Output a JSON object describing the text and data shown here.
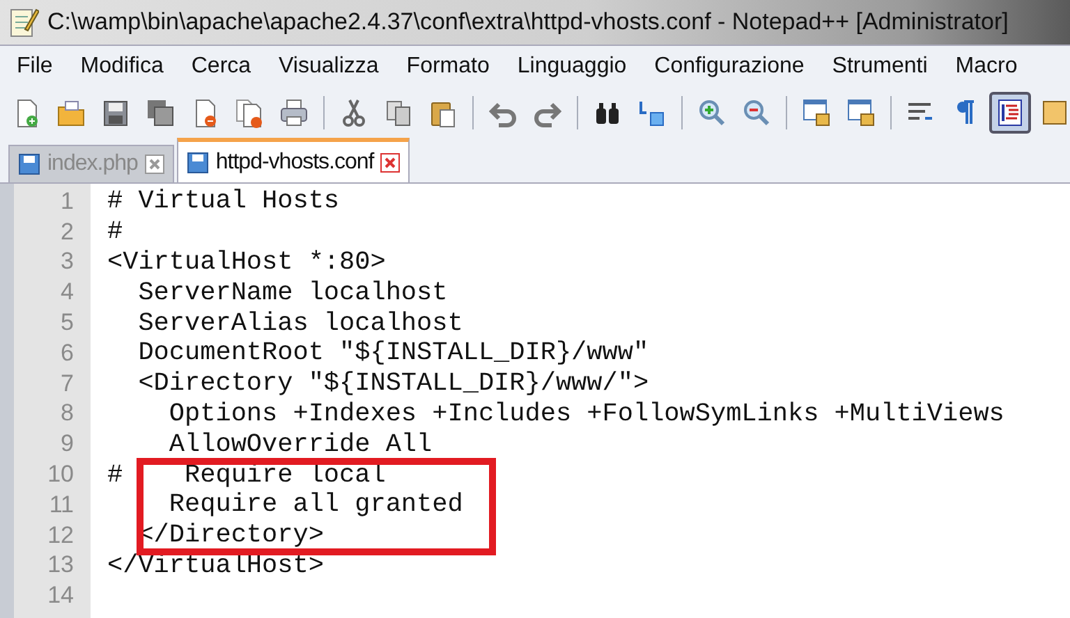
{
  "window": {
    "title": "C:\\wamp\\bin\\apache\\apache2.4.37\\conf\\extra\\httpd-vhosts.conf - Notepad++ [Administrator]"
  },
  "menu": [
    "File",
    "Modifica",
    "Cerca",
    "Visualizza",
    "Formato",
    "Linguaggio",
    "Configurazione",
    "Strumenti",
    "Macro"
  ],
  "toolbar": {
    "buttons": [
      {
        "pressed": false
      },
      {
        "pressed": false
      },
      {
        "pressed": false
      },
      {
        "pressed": false
      },
      {
        "pressed": false
      },
      {
        "pressed": false
      },
      {
        "pressed": false
      },
      {
        "pressed": false
      },
      {
        "pressed": false
      },
      {
        "pressed": false
      },
      {
        "pressed": false
      },
      {
        "pressed": false
      },
      {
        "pressed": false
      },
      {
        "pressed": false
      },
      {
        "pressed": false
      },
      {
        "pressed": false
      },
      {
        "pressed": false
      },
      {
        "pressed": false
      },
      {
        "pressed": false
      },
      {
        "pressed": false
      },
      {
        "pressed": true
      },
      {
        "pressed": false
      }
    ]
  },
  "tabs": [
    {
      "label": "index.php",
      "selected": false
    },
    {
      "label": "httpd-vhosts.conf",
      "selected": true
    }
  ],
  "editor": {
    "lines": [
      {
        "number": "1",
        "code": "# Virtual Hosts",
        "highlighted": false
      },
      {
        "number": "2",
        "code": "#",
        "highlighted": false
      },
      {
        "number": "3",
        "code": "<VirtualHost *:80>",
        "highlighted": false
      },
      {
        "number": "4",
        "code": "  ServerName localhost",
        "highlighted": false
      },
      {
        "number": "5",
        "code": "  ServerAlias localhost",
        "highlighted": false
      },
      {
        "number": "6",
        "code": "  DocumentRoot \"${INSTALL_DIR}/www\"",
        "highlighted": false
      },
      {
        "number": "7",
        "code": "  <Directory \"${INSTALL_DIR}/www/\">",
        "highlighted": false
      },
      {
        "number": "8",
        "code": "    Options +Indexes +Includes +FollowSymLinks +MultiViews",
        "highlighted": false
      },
      {
        "number": "9",
        "code": "    AllowOverride All",
        "highlighted": false
      },
      {
        "number": "10",
        "code": "#    Require local",
        "highlighted": true
      },
      {
        "number": "11",
        "code": "    Require all granted",
        "highlighted": true
      },
      {
        "number": "12",
        "code": "  </Directory>",
        "highlighted": true
      },
      {
        "number": "13",
        "code": "</VirtualHost>",
        "highlighted": false
      },
      {
        "number": "14",
        "highlighted": false
      }
    ]
  }
}
